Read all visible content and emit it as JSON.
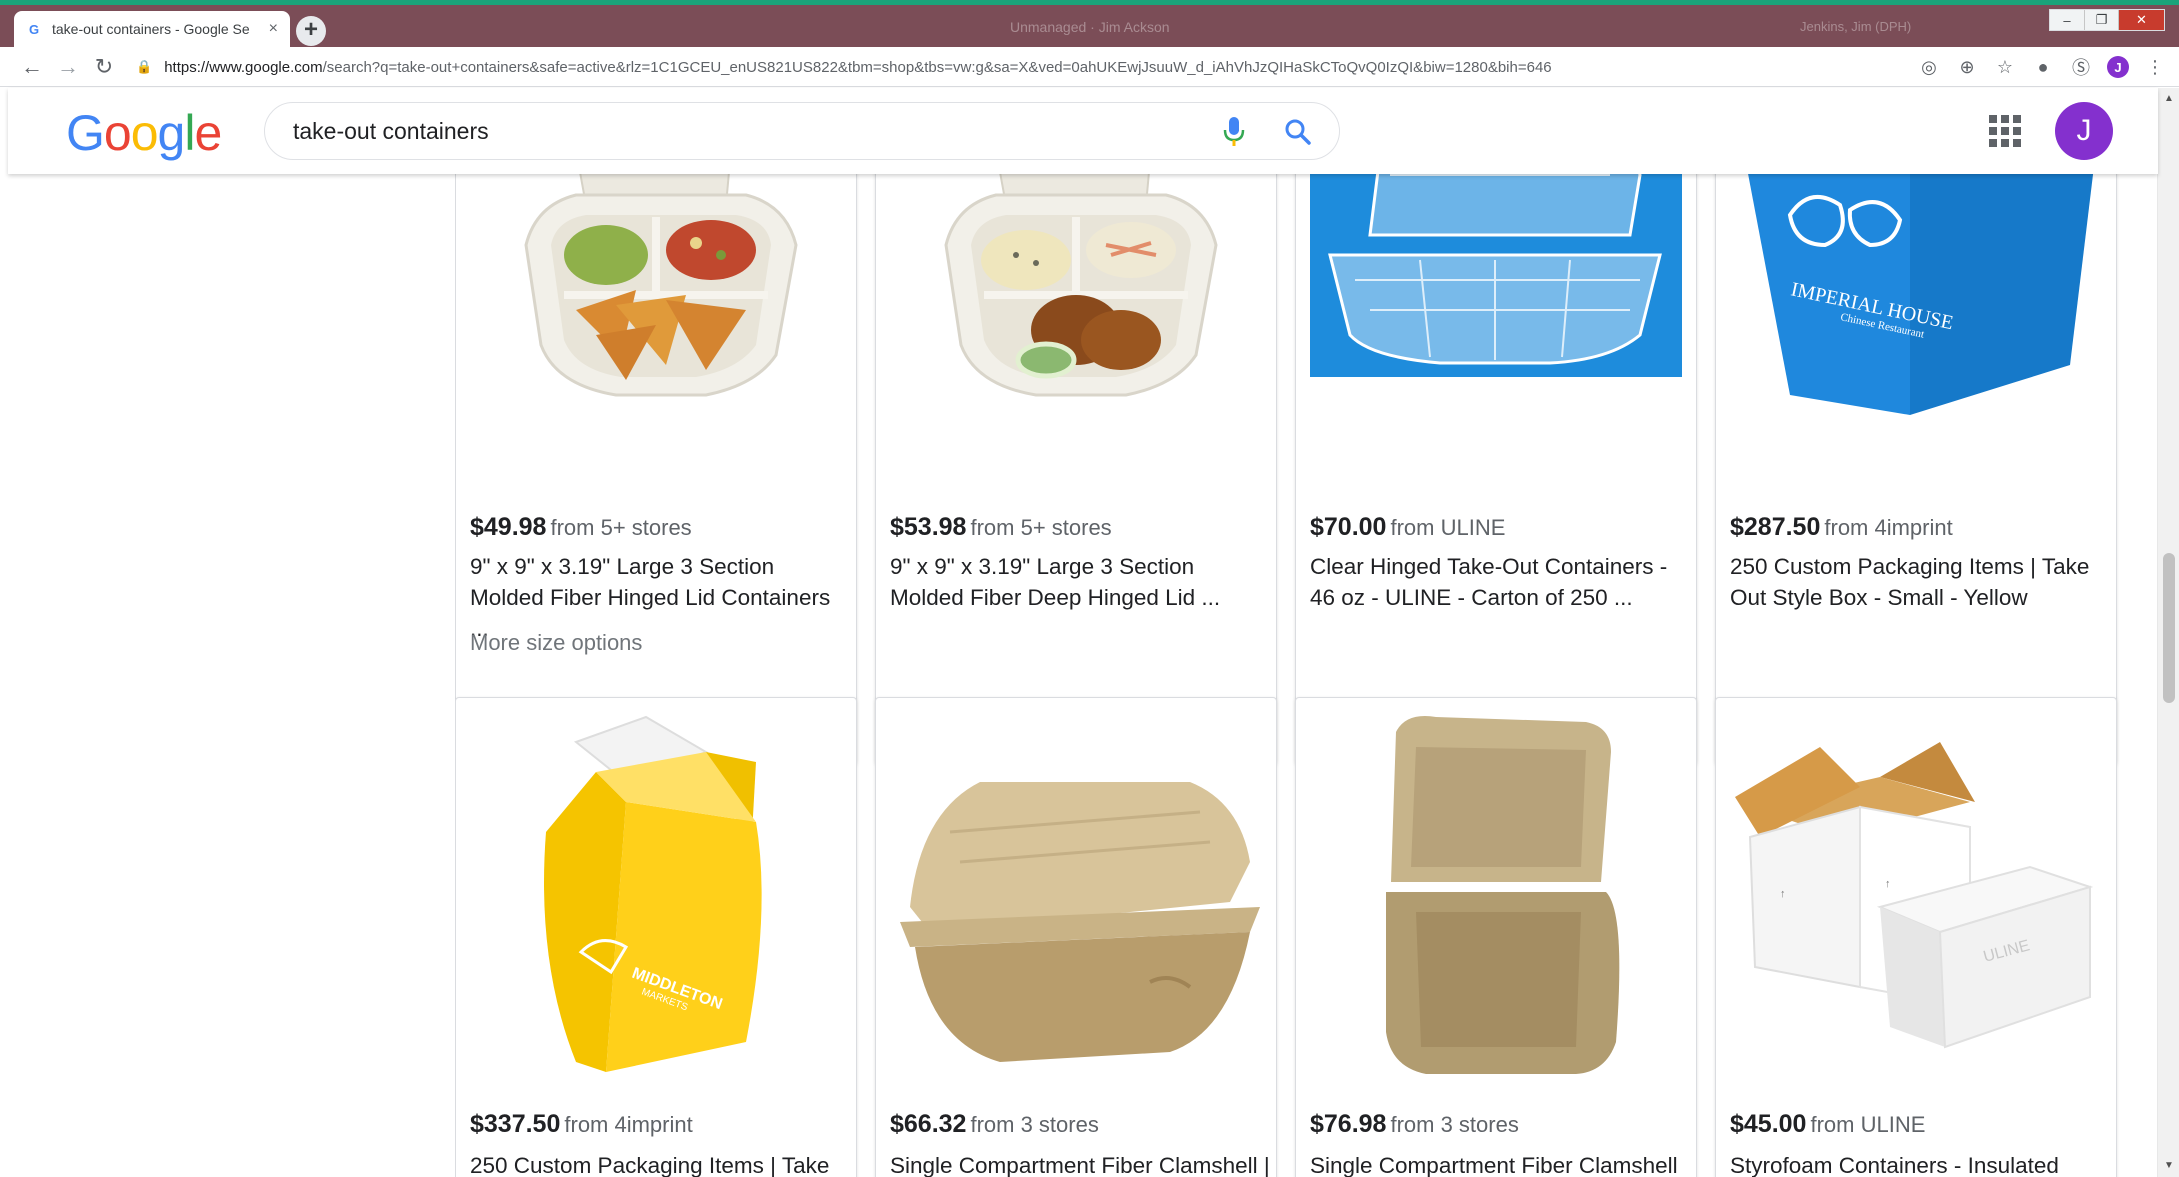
{
  "browser": {
    "tab_title": "take-out containers - Google Se",
    "tab_close": "×",
    "new_tab": "+",
    "incognito_text": "Unmanaged · Jim Ackson",
    "profile_text": "Jenkins, Jim (DPH)",
    "window_controls": [
      "–",
      "❐",
      "✕"
    ],
    "url_host": "https://www.google.com",
    "url_rest": "/search?q=take-out+containers&safe=active&rlz=1C1GCEU_enUS821US822&tbm=shop&tbs=vw:g&sa=X&ved=0ahUKEwjJsuuW_d_iAhVhJzQIHaSkCToQvQ0IzQI&biw=1280&bih=646",
    "profile_initial": "J"
  },
  "header": {
    "logo": [
      "G",
      "o",
      "o",
      "g",
      "l",
      "e"
    ],
    "search_value": "take-out containers",
    "avatar_initial": "J"
  },
  "colors": {
    "tabstrip": "#7b4d57",
    "accent_top": "#1aa37a",
    "avatar": "#8430ce",
    "google_blue": "#4285f4"
  },
  "products": [
    {
      "price": "$49.98",
      "source": "from 5+ stores",
      "title": "9\" x 9\" x 3.19\" Large 3 Section Molded Fiber Hinged Lid Containers ...",
      "extra": "More size options",
      "image": "fiber-3-section-nachos"
    },
    {
      "price": "$53.98",
      "source": "from 5+ stores",
      "title": "9\" x 9\" x 3.19\" Large 3 Section Molded Fiber Deep Hinged Lid ...",
      "image": "fiber-3-section-chicken"
    },
    {
      "price": "$70.00",
      "source": "from ULINE",
      "title": "Clear Hinged Take-Out Containers - 46 oz - ULINE - Carton of 250 ...",
      "image": "clear-hinged-container"
    },
    {
      "price": "$287.50",
      "source": "from 4imprint",
      "title": "250 Custom Packaging Items | Take Out Style Box - Small - Yellow",
      "image": "blue-takeout-box",
      "box_text": [
        "IMPERIAL HOUSE",
        "Chinese Restaurant"
      ]
    },
    {
      "price": "$337.50",
      "source": "from 4imprint",
      "title": "250 Custom Packaging Items | Take",
      "image": "yellow-takeout-box",
      "box_text": [
        "MIDDLETON",
        "MARKETS"
      ]
    },
    {
      "price": "$66.32",
      "source": "from 3 stores",
      "title": "Single Compartment Fiber Clamshell |",
      "image": "fiber-clamshell-side"
    },
    {
      "price": "$76.98",
      "source": "from 3 stores",
      "title": "Single Compartment Fiber Clamshell",
      "image": "fiber-clamshell-open"
    },
    {
      "price": "$45.00",
      "source": "from ULINE",
      "title": "Styrofoam Containers - Insulated",
      "image": "styrofoam-shipper",
      "box_text": [
        "ULINE"
      ]
    }
  ]
}
